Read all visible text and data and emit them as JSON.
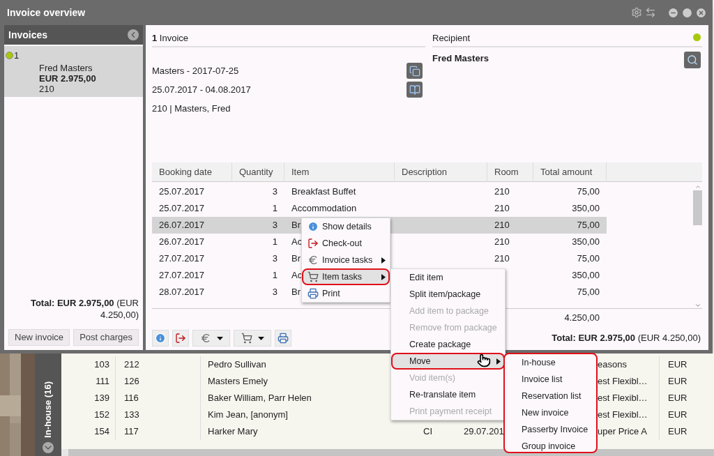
{
  "window": {
    "title": "Invoice overview"
  },
  "sidebar": {
    "title": "Invoices",
    "invoices": [
      {
        "number": "1",
        "name": "Fred Masters",
        "amount": "EUR 2.975,00",
        "room": "210",
        "selected": true,
        "color": "#a8c80a"
      }
    ],
    "total": "**Total: EUR 2.975,00** (EUR 4.250,00)",
    "buttons": [
      "New invoice",
      "Post charges"
    ]
  },
  "invoice": {
    "heading": "**1** Invoice",
    "lines": [
      "Masters - 2017-07-25",
      "25.07.2017 - 04.08.2017",
      "210 | Masters, Fred"
    ]
  },
  "recipient": {
    "heading": "Recipient",
    "color": "#a8c80a",
    "name": "Fred Masters"
  },
  "table": {
    "columns": [
      "Booking date",
      "Quantity",
      "Item",
      "Description",
      "Room",
      "Total amount"
    ],
    "rows": [
      {
        "date": "25.07.2017",
        "quantity": "3",
        "item": "Breakfast Buffet",
        "room": "210",
        "amount": "75,00",
        "selected": false
      },
      {
        "date": "25.07.2017",
        "quantity": "1",
        "item": "Accommodation",
        "room": "210",
        "amount": "350,00",
        "selected": false
      },
      {
        "date": "26.07.2017",
        "quantity": "3",
        "item": "Br",
        "room": "210",
        "amount": "75,00",
        "selected": true
      },
      {
        "date": "26.07.2017",
        "quantity": "1",
        "item": "Ac",
        "room": "210",
        "amount": "350,00",
        "selected": false
      },
      {
        "date": "27.07.2017",
        "quantity": "3",
        "item": "Br",
        "room": "210",
        "amount": "75,00",
        "selected": false
      },
      {
        "date": "27.07.2017",
        "quantity": "1",
        "item": "Ac",
        "amount": "350,00",
        "selected": false
      },
      {
        "date": "28.07.2017",
        "quantity": "3",
        "item": "Br",
        "amount": "75,00",
        "selected": false
      }
    ],
    "sum": "4.250,00",
    "total": "**Total: EUR 2.975,00** (EUR 4.250,00)"
  },
  "context_menu": {
    "items": [
      {
        "label": "Show details",
        "kind": "info",
        "submenu": false,
        "selected": false
      },
      {
        "label": "Check-out",
        "kind": "checkout",
        "submenu": false,
        "selected": false
      },
      {
        "label": "Invoice tasks",
        "kind": "euro",
        "submenu": true,
        "selected": false
      },
      {
        "label": "Item tasks",
        "kind": "cart",
        "submenu": true,
        "selected": true
      },
      {
        "label": "Print",
        "kind": "print",
        "submenu": false,
        "selected": false
      }
    ]
  },
  "item_menu": {
    "items": [
      {
        "label": "Edit item",
        "disabled": false,
        "submenu": false,
        "selected": false
      },
      {
        "label": "Split item/package",
        "disabled": false,
        "submenu": false,
        "selected": false
      },
      {
        "label": "Add item to package",
        "disabled": true,
        "submenu": false,
        "selected": false
      },
      {
        "label": "Remove from package",
        "disabled": true,
        "submenu": false,
        "selected": false
      },
      {
        "label": "Create package",
        "disabled": false,
        "submenu": false,
        "selected": false
      },
      {
        "label": "Move",
        "disabled": false,
        "submenu": true,
        "selected": true
      },
      {
        "label": "Void item(s)",
        "disabled": true,
        "submenu": false,
        "selected": false
      },
      {
        "label": "Re-translate item",
        "disabled": false,
        "submenu": false,
        "selected": false
      },
      {
        "label": "Print payment receipt",
        "disabled": true,
        "submenu": false,
        "selected": false
      }
    ]
  },
  "move_menu": {
    "items": [
      "In-house",
      "Invoice list",
      "Reservation list",
      "New invoice",
      "Passerby Invoice",
      "Group invoice"
    ]
  },
  "background_list": {
    "tab_label": "In-house (16)",
    "rows": [
      {
        "number": "103",
        "room": "212",
        "name": "Pedro Sullivan",
        "rate": "easons",
        "currency": "EUR"
      },
      {
        "number": "111",
        "room": "126",
        "name": "Masters Emely",
        "rate": "est Flexibl…",
        "currency": "EUR"
      },
      {
        "number": "139",
        "room": "116",
        "name": "Baker William, Parr Helen",
        "rate": "est Flexibl…",
        "currency": "EUR"
      },
      {
        "number": "152",
        "room": "133",
        "name": "Kim Jean, [anonym]",
        "rate": "est Flexibl…",
        "currency": "EUR"
      },
      {
        "number": "154",
        "room": "117",
        "name": "Harker Mary",
        "status": "CI",
        "date": "29.07.201",
        "rate": "uper Price A",
        "currency": "EUR"
      }
    ]
  }
}
